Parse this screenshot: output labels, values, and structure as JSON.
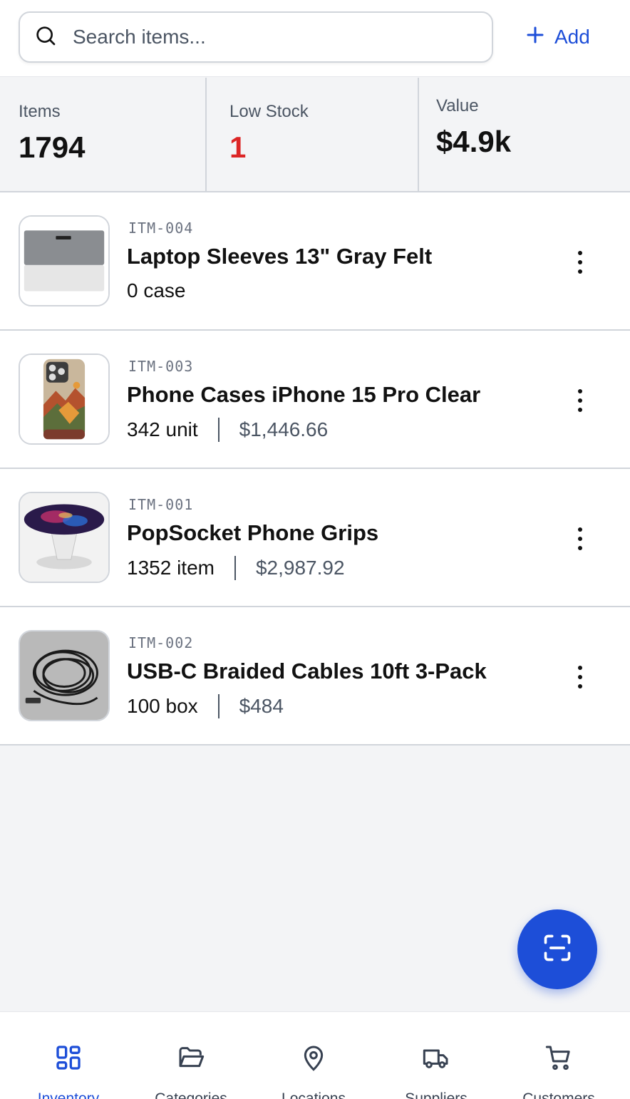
{
  "search": {
    "placeholder": "Search items...",
    "icon": "search-icon"
  },
  "toolbar": {
    "add_label": "Add",
    "add_icon": "plus-icon"
  },
  "stats": {
    "items_label": "Items",
    "items_value": "1794",
    "low_stock_label": "Low Stock",
    "low_stock_value": "1",
    "value_label": "Value",
    "value_value": "$4.9k"
  },
  "items": [
    {
      "sku": "ITM-004",
      "name": "Laptop Sleeves 13\" Gray Felt",
      "qty": "0 case",
      "price": "",
      "image": "laptop-sleeve-image"
    },
    {
      "sku": "ITM-003",
      "name": "Phone Cases iPhone 15 Pro Clear",
      "qty": "342 unit",
      "price": "$1,446.66",
      "image": "phone-case-image"
    },
    {
      "sku": "ITM-001",
      "name": "PopSocket Phone Grips",
      "qty": "1352 item",
      "price": "$2,987.92",
      "image": "popsocket-image"
    },
    {
      "sku": "ITM-002",
      "name": "USB-C Braided Cables 10ft 3-Pack",
      "qty": "100 box",
      "price": "$484",
      "image": "usb-cable-image"
    }
  ],
  "fab": {
    "icon": "scan-icon"
  },
  "tabs": [
    {
      "label": "Inventory",
      "icon": "grid-icon",
      "active": true
    },
    {
      "label": "Categories",
      "icon": "folder-icon",
      "active": false
    },
    {
      "label": "Locations",
      "icon": "map-pin-icon",
      "active": false
    },
    {
      "label": "Suppliers",
      "icon": "truck-icon",
      "active": false
    },
    {
      "label": "Customers",
      "icon": "cart-icon",
      "active": false
    }
  ],
  "colors": {
    "accent": "#1d4ed8",
    "danger": "#dc2626",
    "background": "#f3f4f6",
    "border": "#d1d5db",
    "muted_text": "#4b5563"
  }
}
